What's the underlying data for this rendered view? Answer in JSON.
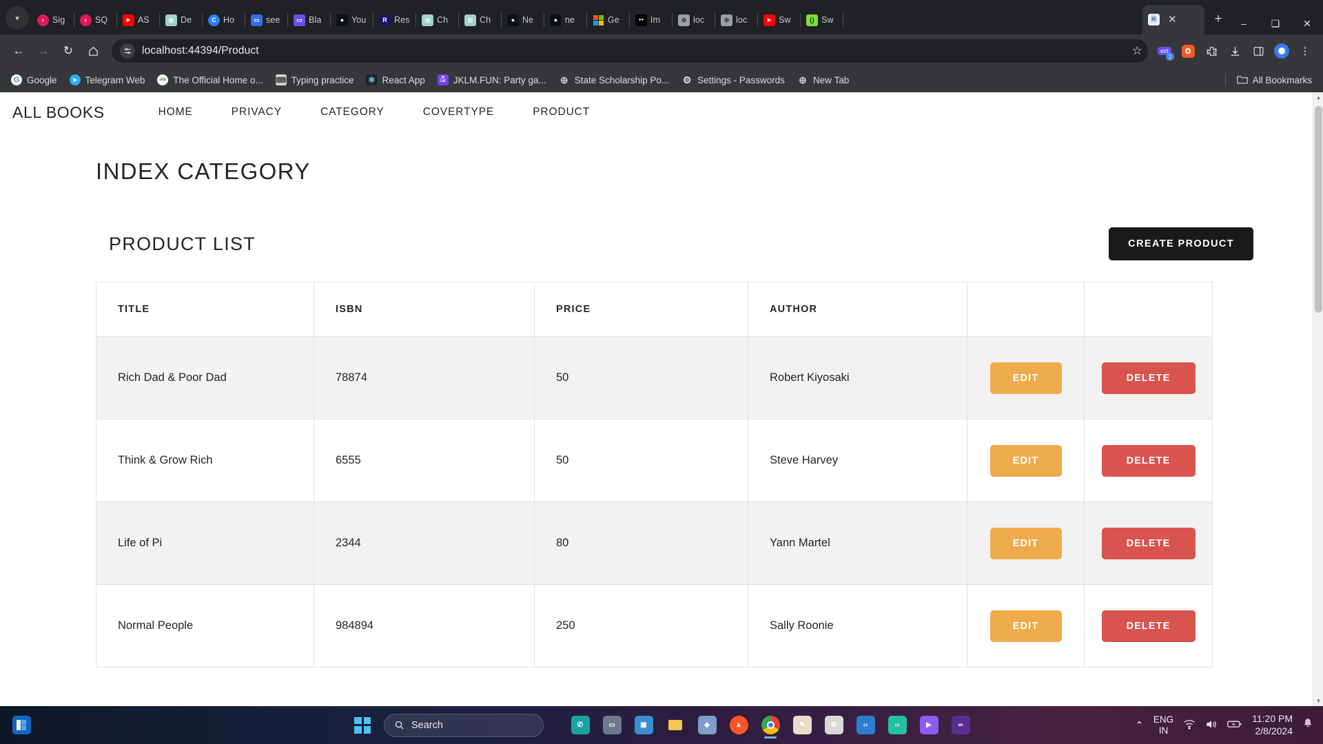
{
  "browser": {
    "tabs": [
      {
        "label": "Sig",
        "icon": "sigma-pink-icon",
        "color": "#e0195c"
      },
      {
        "label": "SQ",
        "icon": "sigma-pink-icon",
        "color": "#e0195c"
      },
      {
        "label": "AS",
        "icon": "youtube-icon",
        "color": "#ff0000"
      },
      {
        "label": "De",
        "icon": "openai-icon",
        "color": "#74aa9c"
      },
      {
        "label": "Ho",
        "icon": "c-circle-icon",
        "color": "#2b7fff"
      },
      {
        "label": "see",
        "icon": "blue-doc-icon",
        "color": "#2f6fed"
      },
      {
        "label": "Bla",
        "icon": "blue-doc-icon",
        "color": "#6a4df4"
      },
      {
        "label": "You",
        "icon": "github-icon",
        "color": "#ffffff"
      },
      {
        "label": "Res",
        "icon": "r-letter-icon",
        "color": "#1b1464"
      },
      {
        "label": "Ch",
        "icon": "openai-icon",
        "color": "#74aa9c"
      },
      {
        "label": "Ch",
        "icon": "openai-icon",
        "color": "#74aa9c"
      },
      {
        "label": "Ne",
        "icon": "github-icon",
        "color": "#ffffff"
      },
      {
        "label": "ne",
        "icon": "github-icon",
        "color": "#ffffff"
      },
      {
        "label": "Ge",
        "icon": "microsoft-icon",
        "color": "#f25022"
      },
      {
        "label": "Im",
        "icon": "medium-icon",
        "color": "#000000"
      },
      {
        "label": "loc",
        "icon": "globe-icon",
        "color": "#9aa0a6"
      },
      {
        "label": "loc",
        "icon": "globe-icon",
        "color": "#9aa0a6"
      },
      {
        "label": "Sw",
        "icon": "youtube-icon",
        "color": "#ff0000"
      },
      {
        "label": "Sw",
        "icon": "swagger-icon",
        "color": "#85ea2d"
      }
    ],
    "active_tab": {
      "label": "",
      "icon": "swagger-doc-icon",
      "close": "✕"
    },
    "new_tab_label": "+",
    "window_controls": {
      "minimize": "–",
      "maximize": "❑",
      "close": "✕"
    },
    "nav": {
      "back": "←",
      "forward": "→",
      "reload": "↻",
      "home": "⌂"
    },
    "omnibox": {
      "site_info_icon": "tune-icon",
      "url": "localhost:44394/Product",
      "bookmark_star": "☆"
    },
    "toolbar_icons": [
      {
        "name": "extensions-badge-icon",
        "glyph": "⬚",
        "badge": "1"
      },
      {
        "name": "recording-icon",
        "glyph": "◉"
      },
      {
        "name": "puzzle-extensions-icon",
        "glyph": "⬚"
      },
      {
        "name": "downloads-icon",
        "glyph": "⤓"
      },
      {
        "name": "side-panel-icon",
        "glyph": "◫"
      },
      {
        "name": "profile-avatar-icon",
        "glyph": "●"
      },
      {
        "name": "chrome-menu-icon",
        "glyph": "⋮"
      }
    ],
    "bookmarks": [
      {
        "label": "Google",
        "icon": "google-icon",
        "color": "#ffffff"
      },
      {
        "label": "Telegram Web",
        "icon": "telegram-icon",
        "color": "#2aabee"
      },
      {
        "label": "The Official Home o...",
        "icon": "vts-icon",
        "color": "#1f7a34"
      },
      {
        "label": "Typing practice",
        "icon": "keyboard-icon",
        "color": "#d7d7d7"
      },
      {
        "label": "React App",
        "icon": "react-icon",
        "color": "#61dafb"
      },
      {
        "label": "JKLM.FUN: Party ga...",
        "icon": "jklm-icon",
        "color": "#7b3ff2"
      },
      {
        "label": "State Scholarship Po...",
        "icon": "globe-icon",
        "color": "#9aa0a6"
      },
      {
        "label": "Settings - Passwords",
        "icon": "gear-icon",
        "color": "#d7d7d7"
      },
      {
        "label": "New Tab",
        "icon": "globe-icon",
        "color": "#9aa0a6"
      }
    ],
    "all_bookmarks_label": "All Bookmarks",
    "all_bookmarks_icon": "folder-icon"
  },
  "site": {
    "brand": "ALL BOOKS",
    "nav_links": [
      "HOME",
      "PRIVACY",
      "CATEGORY",
      "COVERTYPE",
      "PRODUCT"
    ],
    "page_title": "INDEX CATEGORY",
    "section_title": "PRODUCT LIST",
    "create_button": "CREATE PRODUCT",
    "table": {
      "headers": [
        "TITLE",
        "ISBN",
        "PRICE",
        "AUTHOR",
        "",
        ""
      ],
      "edit_label": "EDIT",
      "delete_label": "DELETE",
      "rows": [
        {
          "title": "Rich Dad & Poor Dad",
          "isbn": "78874",
          "price": "50",
          "author": "Robert Kiyosaki"
        },
        {
          "title": "Think & Grow Rich",
          "isbn": "6555",
          "price": "50",
          "author": "Steve Harvey"
        },
        {
          "title": "Life of Pi",
          "isbn": "2344",
          "price": "80",
          "author": "Yann Martel"
        },
        {
          "title": "Normal People",
          "isbn": "984894",
          "price": "250",
          "author": "Sally Roonie"
        }
      ]
    },
    "colors": {
      "edit": "#eeab4c",
      "delete": "#d9534f",
      "create": "#1a1a1a"
    }
  },
  "taskbar": {
    "start_icon": "windows-start-icon",
    "search_placeholder": "Search",
    "search_icon": "search-icon",
    "left_icon": "task-view-icon",
    "apps": [
      {
        "name": "phone-link-icon",
        "color": "#1aa3a3",
        "glyph": "✆"
      },
      {
        "name": "task-view-icon",
        "color": "#6e7a8a",
        "glyph": "▭"
      },
      {
        "name": "teams-icon",
        "color": "#3b8ed0",
        "glyph": "▣"
      },
      {
        "name": "file-explorer-icon",
        "color": "#f2b33d",
        "glyph": "▭"
      },
      {
        "name": "store-icon",
        "color": "#7c9ec9",
        "glyph": "◆"
      },
      {
        "name": "brave-icon",
        "color": "#fb542b",
        "glyph": "▲"
      },
      {
        "name": "chrome-icon",
        "color": "#4285f4",
        "glyph": "●"
      },
      {
        "name": "paint-icon",
        "color": "#e8dcc8",
        "glyph": "✎"
      },
      {
        "name": "settings-icon",
        "color": "#d8d8d8",
        "glyph": "⚙"
      },
      {
        "name": "vscode-icon",
        "color": "#2c7fd0",
        "glyph": "‹›"
      },
      {
        "name": "vscode-insiders-icon",
        "color": "#24bfa5",
        "glyph": "‹›"
      },
      {
        "name": "media-player-icon",
        "color": "#8a5cf0",
        "glyph": "▶"
      },
      {
        "name": "visual-studio-icon",
        "color": "#5c2d91",
        "glyph": "∞"
      }
    ],
    "tray": {
      "chevron": "⌃",
      "language_line1": "ENG",
      "language_line2": "IN",
      "wifi_icon": "wifi-icon",
      "volume_icon": "volume-icon",
      "battery_icon": "battery-charging-icon",
      "time": "11:20 PM",
      "date": "2/8/2024",
      "notification_icon": "bell-icon"
    }
  }
}
